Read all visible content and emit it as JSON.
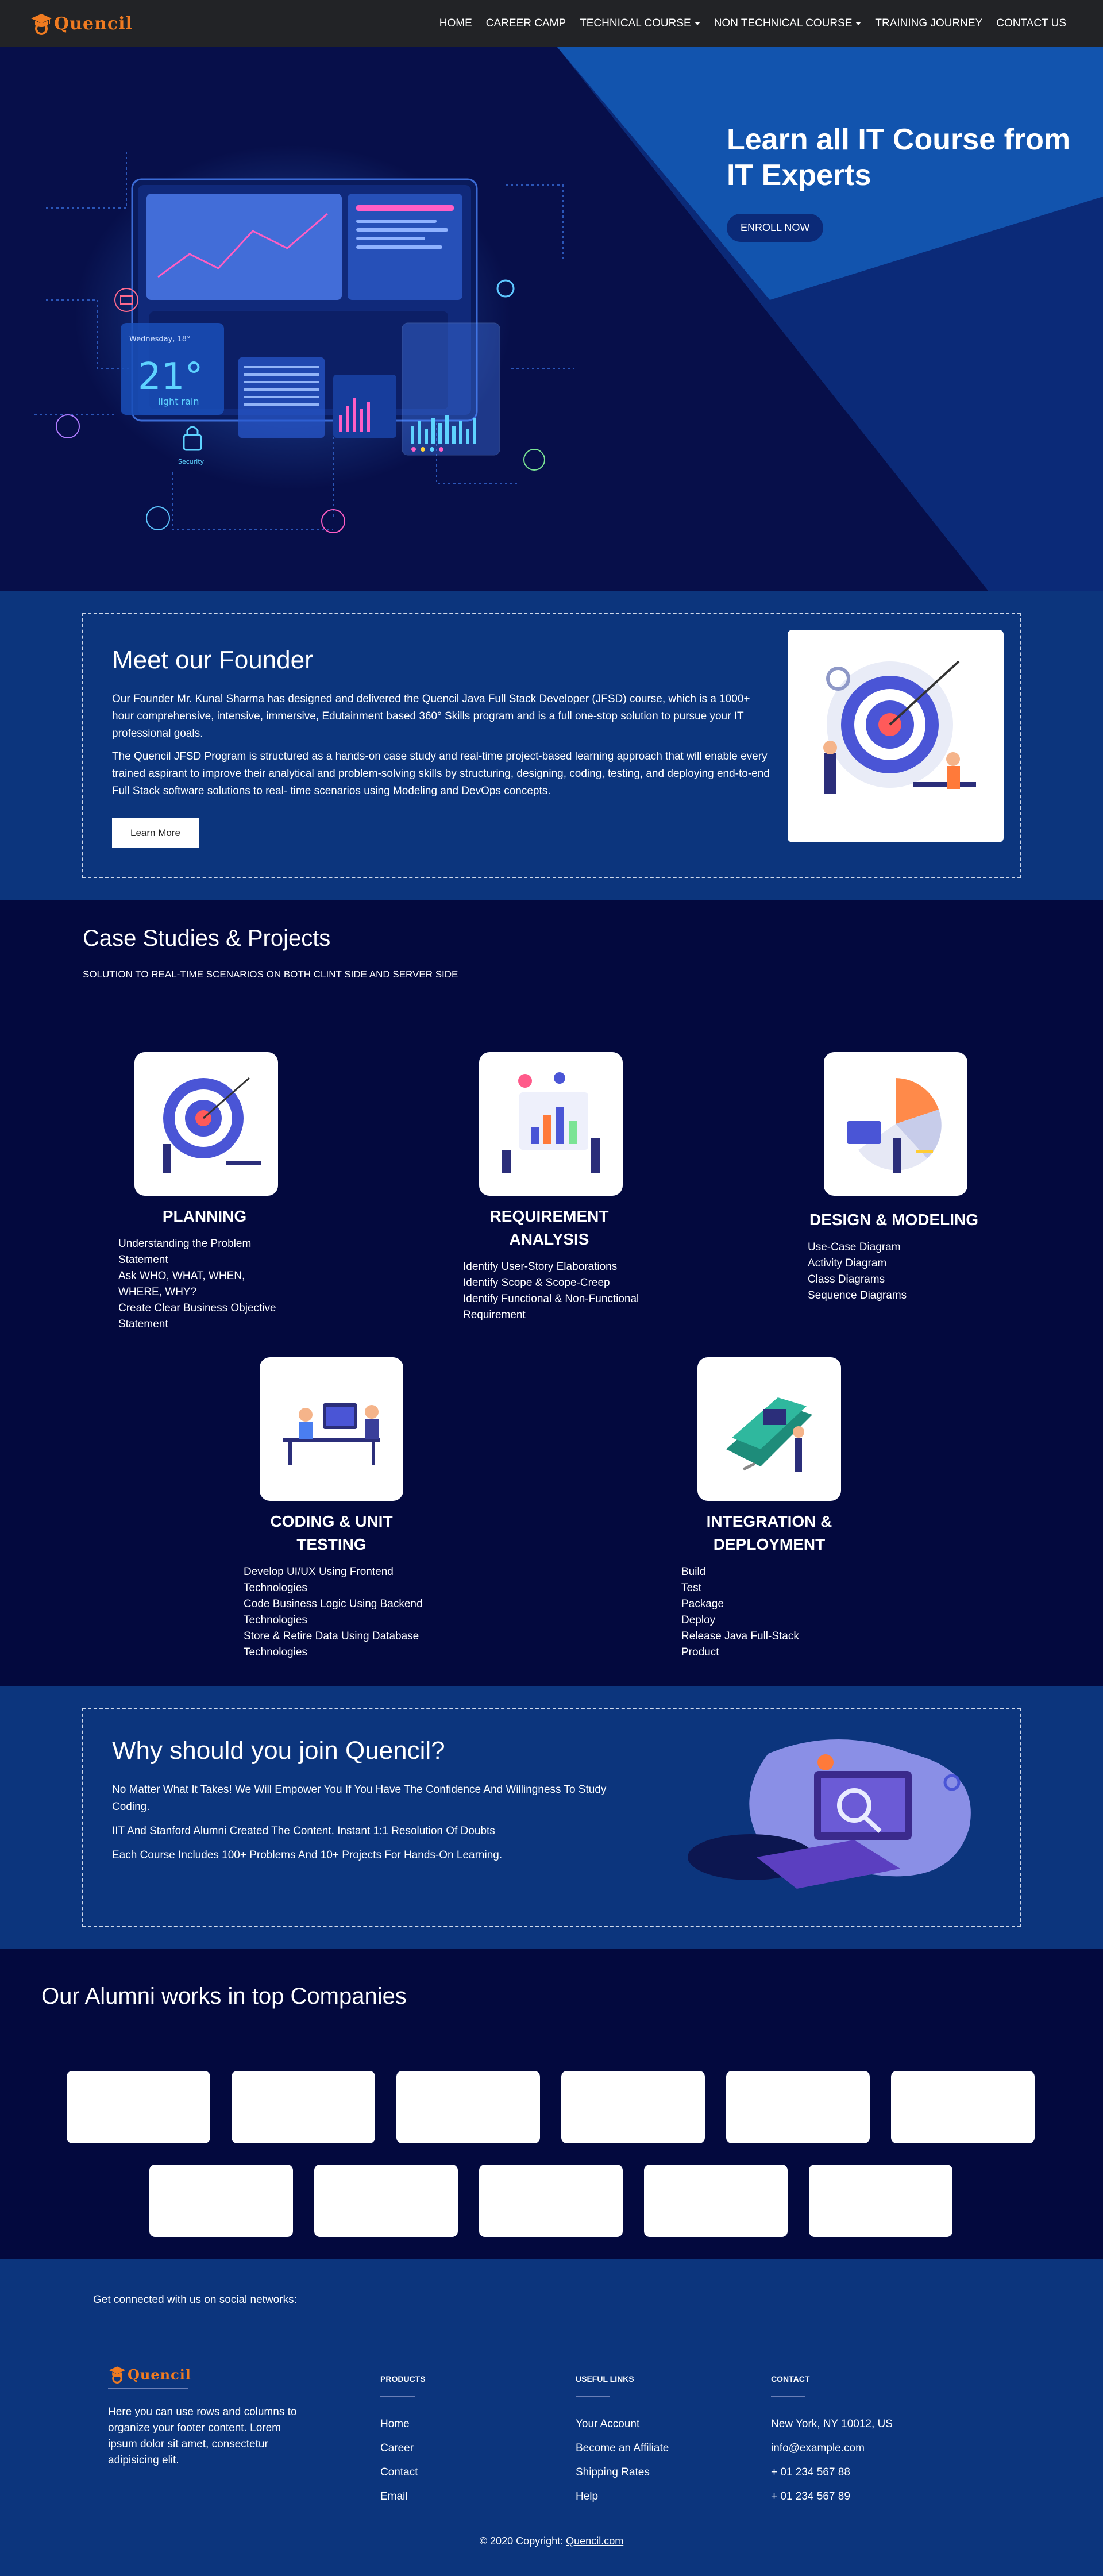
{
  "nav": {
    "brand": "Quencil",
    "items": [
      {
        "label": "HOME",
        "dropdown": false
      },
      {
        "label": "CAREER CAMP",
        "dropdown": false
      },
      {
        "label": "TECHNICAL COURSE",
        "dropdown": true
      },
      {
        "label": "NON TECHNICAL COURSE",
        "dropdown": true
      },
      {
        "label": "TRAINING JOURNEY",
        "dropdown": false
      },
      {
        "label": "CONTACT US",
        "dropdown": false
      }
    ]
  },
  "hero": {
    "title": "Learn all IT Course from IT Experts",
    "button": "ENROLL NOW",
    "widget": {
      "day": "Wednesday, 18°",
      "temp": "21°",
      "cond": "light rain",
      "lock": "Security"
    }
  },
  "founder": {
    "title": "Meet our Founder",
    "p1": "Our Founder Mr. Kunal Sharma has designed and delivered the Quencil Java Full Stack Developer (JFSD) course, which is a 1000+ hour comprehensive, intensive, immersive, Edutainment based 360° Skills program and is a full one-stop solution to pursue your IT professional goals.",
    "p2": "The Quencil JFSD Program is structured as a hands-on case study and real-time project-based learning approach that will enable every trained aspirant to improve their analytical and problem-solving skills by structuring, designing, coding, testing, and deploying end-to-end Full Stack software solutions to real- time scenarios using Modeling and DevOps concepts.",
    "button": "Learn More"
  },
  "cases": {
    "title": "Case Studies & Projects",
    "subtitle": "SOLUTION TO REAL-TIME SCENARIOS ON BOTH CLINT SIDE AND SERVER SIDE",
    "items": [
      {
        "title": "PLANNING",
        "points": [
          "Understanding the Problem Statement",
          "Ask WHO, WHAT, WHEN, WHERE, WHY?",
          "Create Clear Business Objective Statement"
        ]
      },
      {
        "title": "REQUIREMENT ANALYSIS",
        "points": [
          "Identify User-Story Elaborations",
          "Identify Scope & Scope-Creep",
          "Identify Functional & Non-Functional Requirement"
        ]
      },
      {
        "title": "DESIGN & MODELING",
        "points": [
          "Use-Case Diagram",
          "Activity Diagram",
          "Class Diagrams",
          "Sequence Diagrams"
        ]
      },
      {
        "title": "CODING & UNIT TESTING",
        "points": [
          "Develop UI/UX Using Frontend Technologies",
          "Code Business Logic Using Backend Technologies",
          "Store & Retire Data Using Database Technologies"
        ]
      },
      {
        "title": "INTEGRATION & DEPLOYMENT",
        "points": [
          "Build",
          "Test",
          "Package",
          "Deploy",
          "Release Java Full-Stack Product"
        ]
      }
    ]
  },
  "why": {
    "title": "Why should you join Quencil?",
    "points": [
      "No Matter What It Takes! We Will Empower You If You Have The Confidence And Willingness To Study Coding.",
      "IIT And Stanford Alumni Created The Content. Instant 1:1 Resolution Of Doubts",
      "Each Course Includes 100+ Problems And 10+ Projects For Hands-On Learning."
    ]
  },
  "alumni": {
    "title": "Our Alumni works in top Companies",
    "row1_count": 6,
    "row2_count": 5
  },
  "footer": {
    "social": "Get connected with us on social networks:",
    "brand": "Quencil",
    "description": "Here you can use rows and columns to organize your footer content. Lorem ipsum dolor sit amet, consectetur adipisicing elit.",
    "products": {
      "title": "PRODUCTS",
      "links": [
        "Home",
        "Career",
        "Contact",
        "Email"
      ]
    },
    "useful": {
      "title": "USEFUL LINKS",
      "links": [
        "Your Account",
        "Become an Affiliate",
        "Shipping Rates",
        "Help"
      ]
    },
    "contact": {
      "title": "CONTACT",
      "lines": [
        "New York, NY 10012, US",
        "info@example.com",
        "+ 01 234 567 88",
        "+ 01 234 567 89"
      ]
    },
    "copyright_prefix": "© 2020 Copyright:",
    "copyright_link": "Quencil.com"
  }
}
